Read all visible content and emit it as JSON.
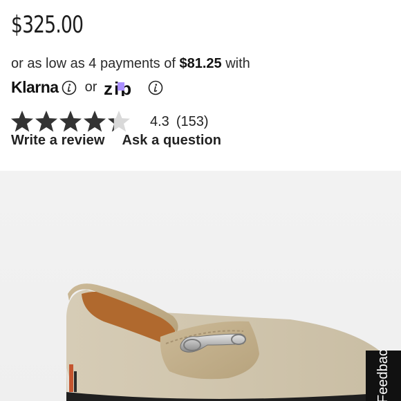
{
  "product": {
    "price": "$325.00",
    "installments_prefix": "or as low as 4 payments of",
    "installment_amount": "$81.25",
    "installments_suffix": "with"
  },
  "bnpl": {
    "klarna_label": "Klarna",
    "or_text": "or",
    "zip_label": "zip"
  },
  "rating": {
    "value": "4.3",
    "count": "(153)",
    "score": 4.3,
    "max": 5
  },
  "links": {
    "write_review": "Write a review",
    "ask_question": "Ask a question"
  },
  "feedback": {
    "label": "Feedback"
  },
  "colors": {
    "star_fill": "#333333",
    "star_empty": "#d9d9d9",
    "zip_accent": "#aa8fff",
    "image_bg": "#f0f0f0"
  },
  "icons": {
    "info": "info-icon",
    "star": "star-icon"
  }
}
